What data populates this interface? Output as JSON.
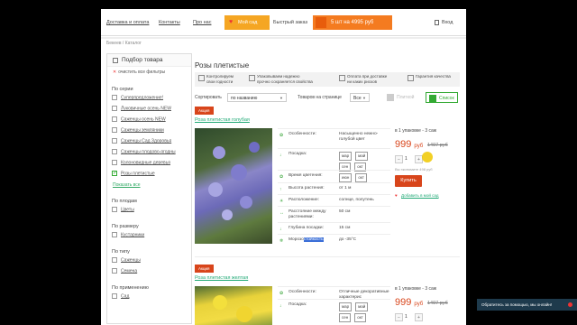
{
  "topbar": {
    "links": [
      "Доставка и оплата",
      "Контакты",
      "Про нас"
    ],
    "my_garden": "Мой сад",
    "quick_order": "Быстрый заказ",
    "cart": "5 шт на 4995 руб",
    "login": "Вход"
  },
  "breadcrumb": "Бекеев / Каталог",
  "sidebar": {
    "title": "Подбор товара",
    "clear": "очистить все фильтры",
    "series_title": "По серии",
    "series": [
      {
        "label": "Суперпредложение!",
        "checked": false
      },
      {
        "label": "Луковичные осень NEW",
        "checked": false
      },
      {
        "label": "Саженцы осень NEW",
        "checked": false
      },
      {
        "label": "Саженцы земляники",
        "checked": false
      },
      {
        "label": "Саженцы Сад Здоровья",
        "checked": false
      },
      {
        "label": "Саженцы плодово-ягодны",
        "checked": false
      },
      {
        "label": "Колоновидные деревья",
        "checked": false
      },
      {
        "label": "Розы плетистые",
        "checked": true
      }
    ],
    "show_all": "Показать все",
    "groups": [
      {
        "title": "По плодам",
        "items": [
          "Цветы"
        ]
      },
      {
        "title": "По размеру",
        "items": [
          "Кустарники"
        ]
      },
      {
        "title": "По типу",
        "items": [
          "Саженцы",
          "Семена"
        ]
      },
      {
        "title": "По применению",
        "items": [
          "Сад"
        ]
      }
    ]
  },
  "main": {
    "title": "Розы плетистые",
    "features": [
      "Контролируем\nсвои годности",
      "Упаковываем надежно\nпрочно сохраняется свойства",
      "Оплата при доставке\nни каких рисков",
      "Гарантия качества"
    ],
    "sort_label": "Сортировать",
    "sort_value": "по названию",
    "per_page_label": "Товаров на странице",
    "per_page_value": "Все",
    "view_grid": "Плиткой",
    "view_list": "Список"
  },
  "products": [
    {
      "badge": "Акция",
      "name": "Роза плетистая голубая",
      "props": [
        {
          "icon": "✿",
          "key": "Особенности:",
          "value": "Насыщенно нежно-голубой цвет"
        },
        {
          "icon": "↓",
          "key": "Посадка:",
          "boxes": [
            "мар",
            "май",
            "сен",
            "окт"
          ]
        },
        {
          "icon": "✿",
          "key": "Время цветения:",
          "boxes": [
            "июн",
            "окт"
          ]
        },
        {
          "icon": "↑",
          "key": "Высота растения:",
          "value": "от 1 м"
        },
        {
          "icon": "☀",
          "key": "Расположение:",
          "value": "солнце, полутень"
        },
        {
          "icon": "↔",
          "key": "Расстояние между растениями:",
          "value": "50 см"
        },
        {
          "icon": "↓",
          "key": "Глубина посадки:",
          "value": "15 см"
        },
        {
          "icon": "❄",
          "key_a": "Морозо",
          "key_b": "стойкость",
          "value": "до -35°С"
        }
      ],
      "pack": "в 1 упаковке - 3 саж",
      "price": "999",
      "currency": "руб",
      "old_price": "1497 руб",
      "qty": "1",
      "note": "Вы экономите 498 руб",
      "buy": "Купить",
      "add_garden": "Добавить в мой сад"
    },
    {
      "badge": "Акция",
      "name": "Роза плетистая желтая",
      "props": [
        {
          "icon": "✿",
          "key": "Особенности:",
          "value": "Отличные декоративные характерис"
        },
        {
          "icon": "↓",
          "key": "Посадка:",
          "boxes": [
            "мар",
            "май",
            "сен",
            "окт"
          ]
        }
      ],
      "pack": "в 1 упаковке - 3 саж",
      "price": "999",
      "currency": "руб",
      "old_price": "1497 руб",
      "qty": "1"
    }
  ],
  "chat": "Обратитесь за помощью, мы онлайн!"
}
